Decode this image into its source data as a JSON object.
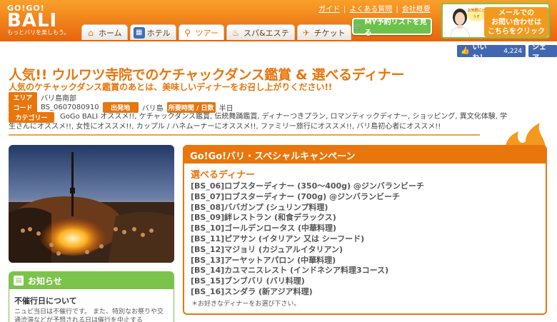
{
  "header": {
    "logo_top": "GO!GO!",
    "logo_main": "BALI",
    "logo_tagline": "もっとバリを楽しもう。",
    "links": [
      "ガイド",
      "よくある質問",
      "会社概要"
    ],
    "nav": [
      {
        "label": "ホーム",
        "icon": "home-icon"
      },
      {
        "label": "ホテル",
        "icon": "hotel-icon"
      },
      {
        "label": "ツアー",
        "icon": "tour-icon"
      },
      {
        "label": "スパ&エステ",
        "icon": "spa-icon"
      },
      {
        "label": "チケット",
        "icon": "ticket-icon"
      }
    ],
    "mylist_label": "MY予約リストを見る",
    "contact_bubble": "お気軽にどうぞ",
    "contact_line1": "メールでの",
    "contact_line2": "お問い合わせは",
    "contact_line3": "こちらをクリック"
  },
  "social": {
    "like_label": "いいね！",
    "like_count": "4,224",
    "share_label": "シェア"
  },
  "tour": {
    "title": "人気!! ウルワツ寺院でのケチャックダンス鑑賞 & 選べるディナー",
    "subtitle": "人気のケチャックダンス鑑賞のあとは、美味しいディナーをお召し上がりください!!",
    "area_tag": "エリア",
    "area_value": "バリ島南部",
    "code_tag": "コード",
    "code_value": "BS_0607080910",
    "depart_tag": "出発地",
    "depart_value": "バリ島",
    "duration_tag": "所要時間 / 日数",
    "duration_value": "半日",
    "category_tag": "カテゴリー",
    "category_value": "GoGo BALI オススメ!!, ケチャックダンス鑑賞, 伝統舞踊鑑賞, ディナーつきプラン, ロマンティックディナー, ショッピング, 異文化体験, 学生さんにオススメ!!, 女性にオススメ!!, カップル / ハネムーナーにオススメ!!, ファミリー旅行にオススメ!!, バリ島初心者にオススメ!!"
  },
  "news": {
    "heading": "お知らせ",
    "title": "不催行日について",
    "text": "ニュピ当日は不催行です。 また、特別なお祭りや交通渋滞などが予想される日は催行を中止する"
  },
  "campaign": {
    "heading": "Go!Go!バリ・スペシャルキャンペーン",
    "subheading": "選べるディナー",
    "items": [
      "[BS_06]ロブスターディナー (350～400g) @ジンバランビーチ",
      "[BS_07]ロブスターディナー (700g) @ジンバランビーチ",
      "[BS_08]ババガンプ (シュリンプ料理)",
      "[BS_09]絆レストラン (和食デラックス)",
      "[BS_10]ゴールデンロータス (中華料理)",
      "[BS_11]ピアサン (イタリアン 又は シーフード)",
      "[BS_12]マジョリ (カジュアルイタリアン)",
      "[BS_13]アーヤットアパロン (中華料理)",
      "[BS_14]カユマニスレスト (インドネシア料理3コース)",
      "[BS_15]ブンブバリ (バリ料理)",
      "[BS_16]スンダラ (新アジア料理)"
    ],
    "note": "＊お好きなディナーをお選び下さい。"
  },
  "colors": {
    "brand_orange": "#e8760c",
    "green": "#7cc34b",
    "facebook": "#4267b2"
  }
}
